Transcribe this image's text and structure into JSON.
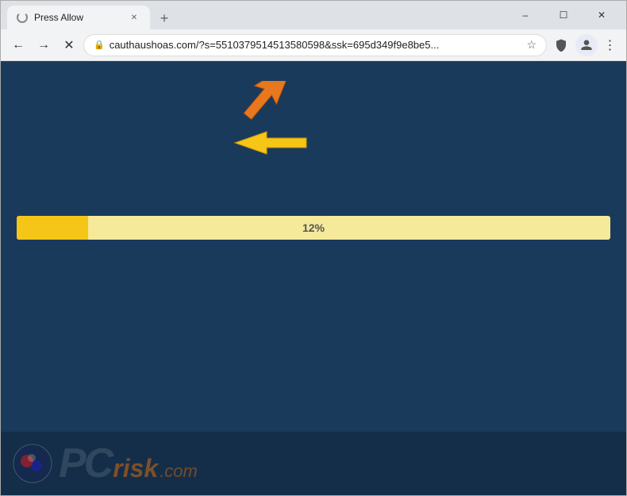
{
  "window": {
    "title": "Press Allow",
    "controls": {
      "minimize": "–",
      "maximize": "☐",
      "close": "✕"
    }
  },
  "toolbar": {
    "url": "cauthaushoas.com/?s=5510379514513580598&ssk=695d349f9e8be5...",
    "new_tab_icon": "+",
    "back_icon": "←",
    "forward_icon": "→",
    "reload_icon": "✕"
  },
  "page": {
    "progress_percent": "12%",
    "progress_value": 12,
    "background_color": "#1a3a5c"
  },
  "watermark": {
    "text_pc": "PC",
    "text_risk": "risk",
    "text_dotcom": ".com"
  }
}
